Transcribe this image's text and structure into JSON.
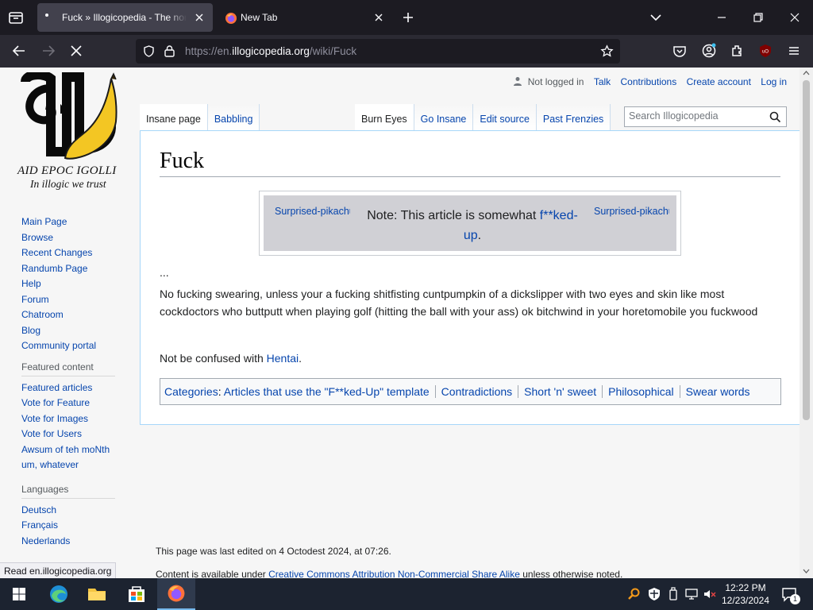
{
  "browser": {
    "tabs": [
      {
        "title": "Fuck » Illogicopedia - The nonsensical encyclopedia",
        "active": true
      },
      {
        "title": "New Tab",
        "active": false
      }
    ],
    "url_prefix": "https://en.",
    "url_domain": "illogicopedia.org",
    "url_path": "/wiki/Fuck"
  },
  "logo": {
    "line1": "AID EPOC IGOLLI",
    "line2": "In illogic we trust"
  },
  "personal": {
    "not_logged_in": "Not logged in",
    "talk": "Talk",
    "contributions": "Contributions",
    "create_account": "Create account",
    "log_in": "Log in"
  },
  "views_left": [
    "Insane page",
    "Babbling"
  ],
  "views_right": [
    "Burn Eyes",
    "Go Insane",
    "Edit source",
    "Past Frenzies"
  ],
  "search": {
    "placeholder": "Search Illogicopedia"
  },
  "sidebar": {
    "nav": [
      "Main Page",
      "Browse",
      "Recent Changes",
      "Randumb Page",
      "Help",
      "Forum",
      "Chatroom",
      "Blog",
      "Community portal"
    ],
    "featured_header": "Featured content",
    "featured": [
      "Featured articles",
      "Vote for Feature",
      "Vote for Images",
      "Vote for Users",
      "Awsum of teh moNth",
      "um, whatever"
    ],
    "languages_header": "Languages",
    "languages": [
      "Deutsch",
      "Français",
      "Nederlands"
    ]
  },
  "article": {
    "title": "Fuck",
    "note": {
      "left_image": "Surprised-pikachu",
      "right_image": "Surprised-pikachu",
      "text_before": "Note: This article is somewhat ",
      "link_part1": "f**ked-",
      "link_part2": "up",
      "text_after": "."
    },
    "ellipsis": "...",
    "paragraph1": "No fucking swearing, unless your a fucking shitfisting cuntpumpkin of a dickslipper with two eyes and skin like most cockdoctors who buttputt when playing golf (hitting the ball with your ass) ok bitchwind in your horetomobile you fuckwood",
    "confused_before": "Not be confused with ",
    "confused_link": "Hentai",
    "confused_after": ".",
    "categories_label": "Categories",
    "categories": [
      "Articles that use the \"F**ked-Up\" template",
      "Contradictions",
      "Short 'n' sweet",
      "Philosophical",
      "Swear words"
    ]
  },
  "footer": {
    "last_edited": "This page was last edited on 4 Octodest 2024, at 07:26.",
    "license_before": "Content is available under ",
    "license_link": "Creative Commons Attribution Non-Commercial Share Alike",
    "license_after": " unless otherwise noted."
  },
  "statusbar": "Read en.illogicopedia.org",
  "taskbar": {
    "time": "12:22 PM",
    "date": "12/23/2024",
    "notification_count": "1"
  }
}
